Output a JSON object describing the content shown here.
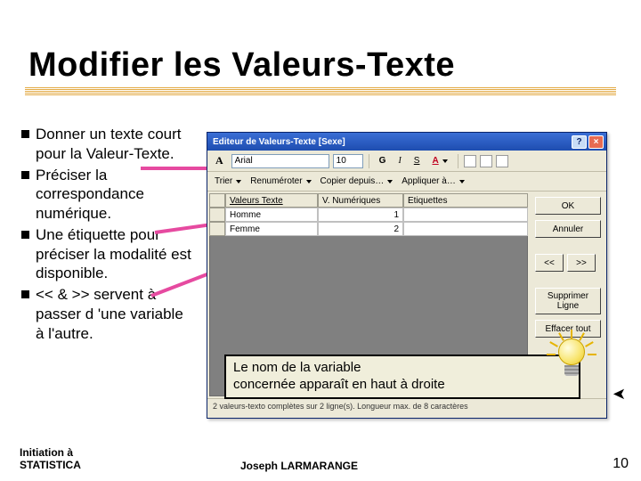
{
  "title": "Modifier les Valeurs-Texte",
  "bullets": {
    "b1": "Donner un texte court pour la Valeur-Texte.",
    "b2": "Préciser la correspondance numérique.",
    "b3": "Une étiquette pour préciser la modalité est disponible.",
    "b4": "<< & >> servent à passer d 'une variable à l'autre."
  },
  "footer": {
    "left_l1": "Initiation à",
    "left_l2": "STATISTICA",
    "center": "Joseph LARMARANGE",
    "page": "10"
  },
  "dialog": {
    "caption": "Editeur de Valeurs-Texte [Sexe]",
    "font_label": "A",
    "font_family": "Arial",
    "font_size": "10",
    "btn_bold": "G",
    "btn_italic": "I",
    "btn_underline": "S",
    "btn_color": "A",
    "menu_trier": "Trier",
    "menu_renum": "Renuméroter",
    "menu_copier": "Copier depuis…",
    "menu_appliquer": "Appliquer à…",
    "headers": {
      "h1": "Valeurs Texte",
      "h2": "V. Numériques",
      "h3": "Etiquettes"
    },
    "rows": [
      {
        "t": "Homme",
        "n": "1",
        "e": ""
      },
      {
        "t": "Femme",
        "n": "2",
        "e": ""
      }
    ],
    "buttons": {
      "ok": "OK",
      "cancel": "Annuler",
      "prev": "<<",
      "next": ">>",
      "suppr": "Supprimer Ligne",
      "effacer": "Effacer tout"
    },
    "status": "2 valeurs-texto complètes sur 2 ligne(s). Longueur max. de 8 caractères"
  },
  "callout": {
    "l1": "Le nom de la variable",
    "l2": "concernée apparaît en haut à droite"
  }
}
